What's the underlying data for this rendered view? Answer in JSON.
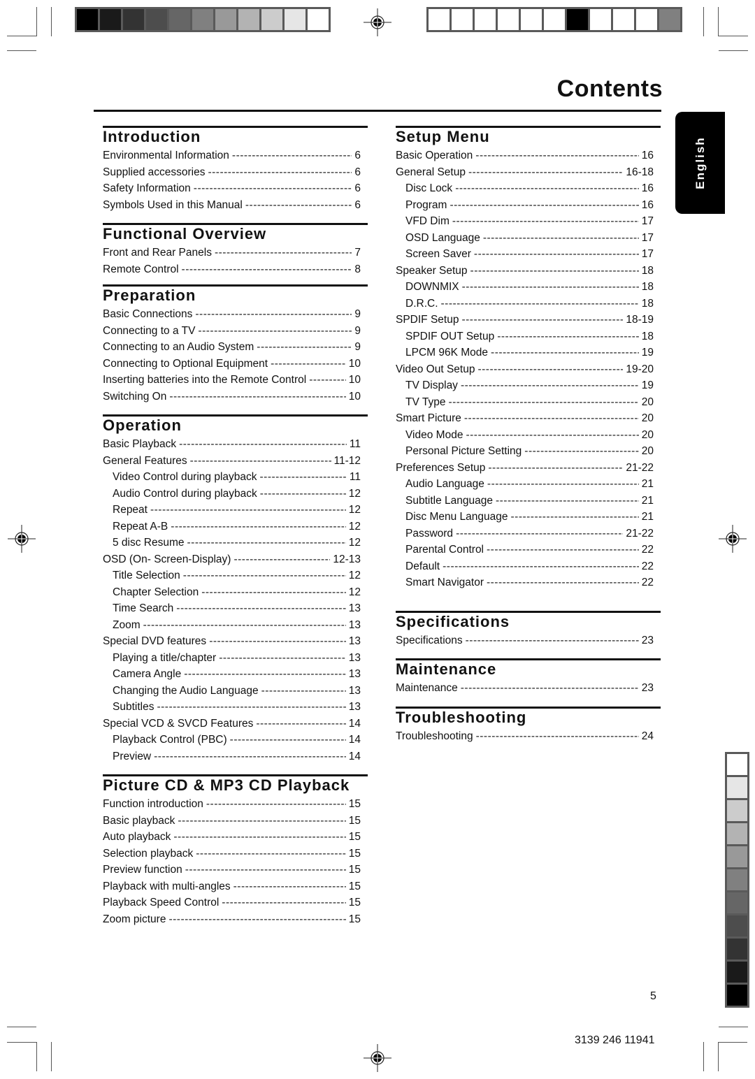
{
  "page": {
    "title": "Contents",
    "language_tab": "English",
    "page_number": "5",
    "document_code": "3139 246 11941"
  },
  "print_marks": {
    "top_left_gray_scale": [
      "#000000",
      "#1a1a1a",
      "#333333",
      "#4d4d4d",
      "#666666",
      "#808080",
      "#999999",
      "#b3b3b3",
      "#cccccc",
      "#e6e6e6",
      "#ffffff"
    ],
    "top_right_blocks": [
      "#ffffff",
      "#ffffff",
      "#ffffff",
      "#ffffff",
      "#ffffff",
      "#ffffff",
      "#000000",
      "#ffffff",
      "#ffffff",
      "#ffffff",
      "#808080"
    ],
    "right_side_gray_scale": [
      "#ffffff",
      "#e6e6e6",
      "#cccccc",
      "#b3b3b3",
      "#999999",
      "#808080",
      "#666666",
      "#4d4d4d",
      "#333333",
      "#1a1a1a",
      "#000000"
    ]
  },
  "left_column": [
    {
      "heading": "Introduction",
      "entries": [
        {
          "label": "Environmental Information",
          "page": "6",
          "sub": false
        },
        {
          "label": "Supplied accessories",
          "page": "6",
          "sub": false
        },
        {
          "label": "Safety Information",
          "page": "6",
          "sub": false
        },
        {
          "label": "Symbols Used in this Manual",
          "page": "6",
          "sub": false
        }
      ]
    },
    {
      "heading": "Functional Overview",
      "entries": [
        {
          "label": "Front and Rear Panels",
          "page": "7",
          "sub": false
        },
        {
          "label": "Remote Control",
          "page": "8",
          "sub": false
        }
      ]
    },
    {
      "heading": "Preparation",
      "entries": [
        {
          "label": "Basic Connections",
          "page": "9",
          "sub": false
        },
        {
          "label": "Connecting to a TV",
          "page": "9",
          "sub": false
        },
        {
          "label": "Connecting to an Audio System",
          "page": "9",
          "sub": false
        },
        {
          "label": "Connecting to Optional Equipment",
          "page": "10",
          "sub": false
        },
        {
          "label": "Inserting batteries into the Remote Control",
          "page": "10",
          "sub": false
        },
        {
          "label": "Switching On",
          "page": "10",
          "sub": false
        }
      ]
    },
    {
      "heading": "Operation",
      "entries": [
        {
          "label": "Basic Playback",
          "page": "11",
          "sub": false
        },
        {
          "label": "General Features",
          "page": "11-12",
          "sub": false
        },
        {
          "label": "Video Control during playback",
          "page": "11",
          "sub": true
        },
        {
          "label": "Audio Control during playback",
          "page": "12",
          "sub": true
        },
        {
          "label": "Repeat",
          "page": "12",
          "sub": true
        },
        {
          "label": "Repeat A-B",
          "page": "12",
          "sub": true
        },
        {
          "label": "5 disc Resume",
          "page": "12",
          "sub": true
        },
        {
          "label": "OSD (On- Screen-Display)",
          "page": "12-13",
          "sub": false
        },
        {
          "label": "Title Selection",
          "page": "12",
          "sub": true
        },
        {
          "label": "Chapter Selection",
          "page": "12",
          "sub": true
        },
        {
          "label": "Time Search",
          "page": "13",
          "sub": true
        },
        {
          "label": "Zoom",
          "page": "13",
          "sub": true
        },
        {
          "label": "Special DVD features",
          "page": "13",
          "sub": false
        },
        {
          "label": "Playing a title/chapter",
          "page": "13",
          "sub": true
        },
        {
          "label": "Camera Angle",
          "page": "13",
          "sub": true
        },
        {
          "label": "Changing the Audio Language",
          "page": "13",
          "sub": true
        },
        {
          "label": "Subtitles",
          "page": "13",
          "sub": true
        },
        {
          "label": "Special VCD & SVCD Features",
          "page": "14",
          "sub": false
        },
        {
          "label": "Playback Control (PBC)",
          "page": "14",
          "sub": true
        },
        {
          "label": "Preview",
          "page": "14",
          "sub": true
        }
      ]
    },
    {
      "heading": "Picture CD & MP3 CD Playback",
      "entries": [
        {
          "label": "Function introduction",
          "page": "15",
          "sub": false
        },
        {
          "label": "Basic playback",
          "page": "15",
          "sub": false
        },
        {
          "label": "Auto playback",
          "page": "15",
          "sub": false
        },
        {
          "label": "Selection playback",
          "page": "15",
          "sub": false
        },
        {
          "label": "Preview function",
          "page": "15",
          "sub": false
        },
        {
          "label": "Playback with multi-angles",
          "page": "15",
          "sub": false
        },
        {
          "label": "Playback Speed Control",
          "page": "15",
          "sub": false
        },
        {
          "label": "Zoom picture",
          "page": "15",
          "sub": false
        }
      ]
    }
  ],
  "right_column": [
    {
      "heading": "Setup Menu",
      "entries": [
        {
          "label": "Basic Operation",
          "page": "16",
          "sub": false
        },
        {
          "label": "General Setup",
          "page": "16-18",
          "sub": false
        },
        {
          "label": "Disc Lock",
          "page": "16",
          "sub": true
        },
        {
          "label": "Program",
          "page": "16",
          "sub": true
        },
        {
          "label": "VFD Dim",
          "page": "17",
          "sub": true
        },
        {
          "label": "OSD Language",
          "page": "17",
          "sub": true
        },
        {
          "label": "Screen Saver",
          "page": "17",
          "sub": true
        },
        {
          "label": "Speaker Setup",
          "page": "18",
          "sub": false
        },
        {
          "label": "DOWNMIX",
          "page": "18",
          "sub": true
        },
        {
          "label": "D.R.C.",
          "page": "18",
          "sub": true
        },
        {
          "label": "SPDIF Setup",
          "page": "18-19",
          "sub": false
        },
        {
          "label": "SPDIF OUT Setup",
          "page": "18",
          "sub": true
        },
        {
          "label": "LPCM 96K Mode",
          "page": "19",
          "sub": true
        },
        {
          "label": "Video Out Setup",
          "page": "19-20",
          "sub": false
        },
        {
          "label": "TV Display",
          "page": "19",
          "sub": true
        },
        {
          "label": "TV Type",
          "page": "20",
          "sub": true
        },
        {
          "label": "Smart Picture",
          "page": "20",
          "sub": false
        },
        {
          "label": "Video Mode",
          "page": "20",
          "sub": true
        },
        {
          "label": "Personal Picture Setting",
          "page": "20",
          "sub": true
        },
        {
          "label": "Preferences Setup",
          "page": "21-22",
          "sub": false
        },
        {
          "label": "Audio Language",
          "page": "21",
          "sub": true
        },
        {
          "label": "Subtitle Language",
          "page": "21",
          "sub": true
        },
        {
          "label": "Disc Menu Language",
          "page": "21",
          "sub": true
        },
        {
          "label": "Password",
          "page": "21-22",
          "sub": true
        },
        {
          "label": "Parental Control",
          "page": "22",
          "sub": true
        },
        {
          "label": "Default",
          "page": "22",
          "sub": true
        },
        {
          "label": "Smart Navigator",
          "page": "22",
          "sub": true
        }
      ]
    },
    {
      "heading": "Specifications",
      "entries": [
        {
          "label": "Specifications",
          "page": "23",
          "sub": false
        }
      ]
    },
    {
      "heading": "Maintenance",
      "entries": [
        {
          "label": "Maintenance",
          "page": "23",
          "sub": false
        }
      ]
    },
    {
      "heading": "Troubleshooting",
      "entries": [
        {
          "label": "Troubleshooting",
          "page": "24",
          "sub": false
        }
      ]
    }
  ]
}
